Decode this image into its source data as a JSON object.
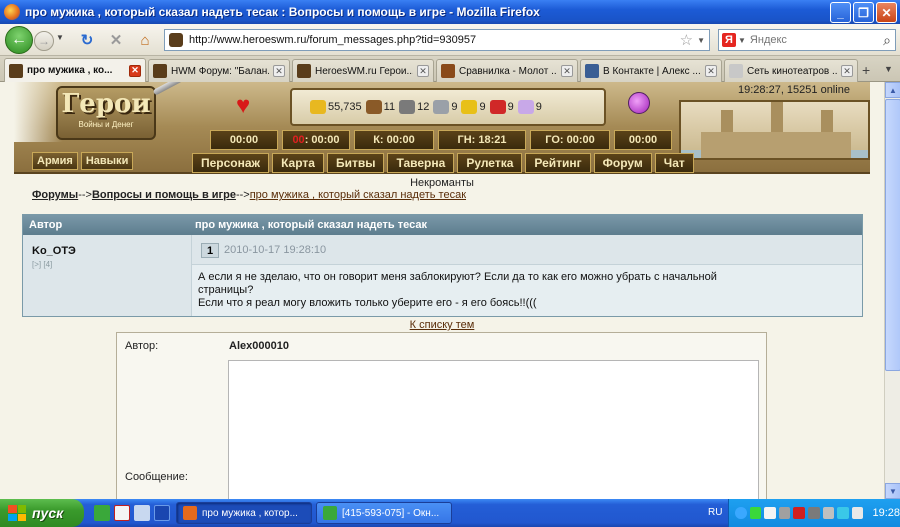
{
  "window": {
    "title": "про мужика , который сказал надеть тесак : Вопросы и помощь в игре - Mozilla Firefox"
  },
  "nav": {
    "url": "http://www.heroeswm.ru/forum_messages.php?tid=930957",
    "search_placeholder": "Яндекс",
    "search_engine_letter": "Я"
  },
  "tabs": [
    {
      "label": "про мужика , ко...",
      "icon_color": "#5a3d1b",
      "active": true
    },
    {
      "label": "HWM Форум: \"Балан...",
      "icon_color": "#5a3d1b",
      "active": false
    },
    {
      "label": "HeroesWM.ru Герои...",
      "icon_color": "#5a3d1b",
      "active": false
    },
    {
      "label": "Сравнилка - Молот ...",
      "icon_color": "#8a4a1a",
      "active": false
    },
    {
      "label": "В Контакте | Алекс ...",
      "icon_color": "#3a5e94",
      "active": false
    },
    {
      "label": "Сеть кинотеатров ...",
      "icon_color": "#c8c8c8",
      "active": false
    }
  ],
  "game": {
    "logo_main": "Герои",
    "logo_sub": "Войны и Денег",
    "time_online": "19:28:27, 15251 online",
    "resources": [
      {
        "value": "55,735",
        "icon": "gold-icon",
        "color": "#e8b820"
      },
      {
        "value": "11",
        "icon": "wood-icon",
        "color": "#8a5a28"
      },
      {
        "value": "12",
        "icon": "ore-icon",
        "color": "#7a7a7a"
      },
      {
        "value": "9",
        "icon": "mercury-icon",
        "color": "#9aa0a8"
      },
      {
        "value": "9",
        "icon": "sulfur-icon",
        "color": "#e8c018"
      },
      {
        "value": "9",
        "icon": "crystal-icon",
        "color": "#d02828"
      },
      {
        "value": "9",
        "icon": "gem-icon",
        "color": "#c8a8e8"
      }
    ],
    "timers": [
      {
        "label": "00:00",
        "prefix": ""
      },
      {
        "label": ": 00:00",
        "prefix": "00"
      },
      {
        "label": "К: 00:00",
        "prefix": ""
      },
      {
        "label": "ГН: 18:21",
        "prefix": ""
      },
      {
        "label": "ГО: 00:00",
        "prefix": ""
      },
      {
        "label": "00:00",
        "prefix": ""
      }
    ],
    "army_buttons": [
      "Армия",
      "Навыки"
    ],
    "menu": [
      "Персонаж",
      "Карта",
      "Битвы",
      "Таверна",
      "Рулетка",
      "Рейтинг",
      "Форум",
      "Чат"
    ]
  },
  "forum": {
    "faction": "Некроманты",
    "breadcrumb": {
      "root": "Форумы",
      "sep1": "-->",
      "section": "Вопросы и помощь в игре",
      "sep2": "-->",
      "topic": "про мужика , который сказал надеть тесак"
    },
    "table": {
      "col_author": "Автор",
      "col_topic": "про мужика , который сказал надеть тесак"
    },
    "post": {
      "author": "Ko_OTЭ",
      "author_meta": "[>] [4]",
      "number": "1",
      "date": "2010-10-17 19:28:10",
      "text_line1": "А если я не зделаю, что он говорит меня заблокируют? Если да то как его можно убрать с начальной",
      "text_line2": "страницы?",
      "text_line3": "Если что я реал могу вложить только уберите его - я его боясь!!((("
    },
    "to_list": "К списку тем",
    "reply": {
      "author_label": "Автор:",
      "author_value": "Alex000010",
      "message_label": "Сообщение:"
    }
  },
  "taskbar": {
    "start": "пуск",
    "tasks": [
      {
        "label": "про мужика , котор...",
        "active": true,
        "icon_color": "#e46a1c"
      },
      {
        "label": "[415-593-075] - Окн...",
        "active": false,
        "icon_color": "#3aa83a"
      }
    ],
    "lang": "RU",
    "clock": "19:28"
  }
}
